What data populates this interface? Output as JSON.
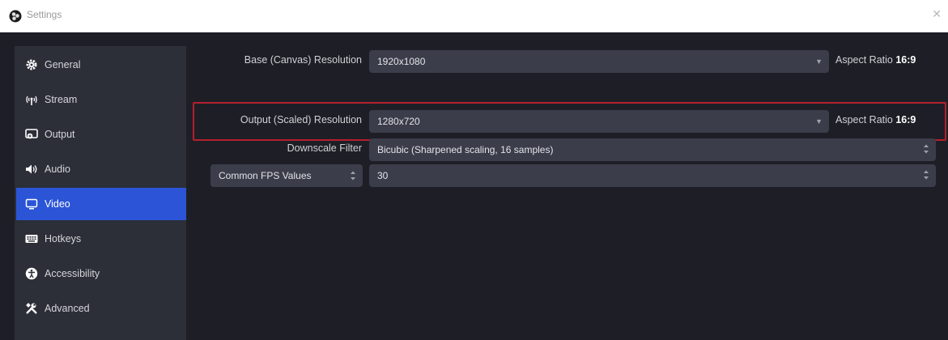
{
  "window": {
    "title": "Settings",
    "close_glyph": "✕"
  },
  "sidebar": {
    "items": [
      {
        "label": "General",
        "icon": "gear-icon"
      },
      {
        "label": "Stream",
        "icon": "antenna-icon"
      },
      {
        "label": "Output",
        "icon": "output-icon"
      },
      {
        "label": "Audio",
        "icon": "speaker-icon"
      },
      {
        "label": "Video",
        "icon": "monitor-icon",
        "active": true
      },
      {
        "label": "Hotkeys",
        "icon": "keyboard-icon"
      },
      {
        "label": "Accessibility",
        "icon": "accessibility-icon"
      },
      {
        "label": "Advanced",
        "icon": "wrench-icon"
      }
    ]
  },
  "video": {
    "base_resolution": {
      "label": "Base (Canvas) Resolution",
      "value": "1920x1080",
      "aspect_prefix": "Aspect Ratio",
      "aspect_value": "16:9"
    },
    "output_resolution": {
      "label": "Output (Scaled) Resolution",
      "value": "1280x720",
      "aspect_prefix": "Aspect Ratio",
      "aspect_value": "16:9"
    },
    "downscale_filter": {
      "label": "Downscale Filter",
      "value": "Bicubic (Sharpened scaling, 16 samples)"
    },
    "fps": {
      "type_value": "Common FPS Values",
      "value": "30"
    }
  },
  "colors": {
    "accent": "#2b55d6",
    "highlight_border": "#b3202e",
    "sidebar_bg": "#2c2e38",
    "content_bg": "#1e1f26"
  }
}
